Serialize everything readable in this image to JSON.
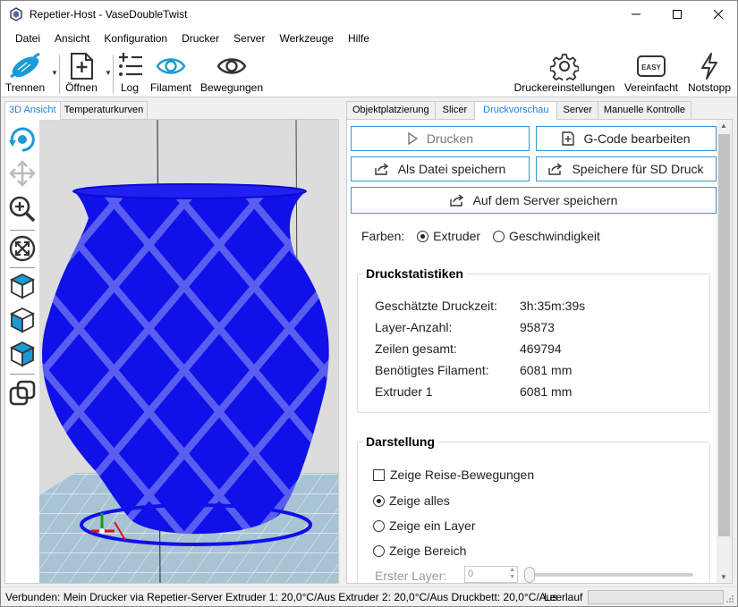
{
  "window": {
    "title": "Repetier-Host - VaseDoubleTwist"
  },
  "menu": [
    "Datei",
    "Ansicht",
    "Konfiguration",
    "Drucker",
    "Server",
    "Werkzeuge",
    "Hilfe"
  ],
  "toolbar": {
    "trennen": "Trennen",
    "oeffnen": "Öffnen",
    "log": "Log",
    "filament": "Filament",
    "bewegungen": "Bewegungen",
    "druckereinstellungen": "Druckereinstellungen",
    "vereinfacht": "Vereinfacht",
    "easy_badge": "EASY",
    "notstopp": "Notstopp"
  },
  "left_tabs": [
    "3D Ansicht",
    "Temperaturkurven"
  ],
  "right_tabs": [
    "Objektplatzierung",
    "Slicer",
    "Druckvorschau",
    "Server",
    "Manuelle Kontrolle"
  ],
  "buttons": {
    "drucken": "Drucken",
    "gcode": "G-Code bearbeiten",
    "als_datei": "Als Datei speichern",
    "sd": "Speichere für SD Druck",
    "server": "Auf dem Server speichern"
  },
  "farben": {
    "label": "Farben:",
    "extruder": "Extruder",
    "geschwindigkeit": "Geschwindigkeit"
  },
  "stats": {
    "title": "Druckstatistiken",
    "rows": [
      {
        "label": "Geschätzte Druckzeit:",
        "value": "3h:35m:39s"
      },
      {
        "label": "Layer-Anzahl:",
        "value": "95873"
      },
      {
        "label": "Zeilen gesamt:",
        "value": "469794"
      },
      {
        "label": "Benötigtes Filament:",
        "value": "6081 mm"
      },
      {
        "label": "Extruder 1",
        "value": "6081 mm"
      }
    ]
  },
  "display": {
    "title": "Darstellung",
    "reise": "Zeige Reise-Bewegungen",
    "alles": "Zeige alles",
    "layer": "Zeige ein Layer",
    "bereich": "Zeige Bereich",
    "erster_layer": "Erster Layer:",
    "erster_layer_value": "0"
  },
  "status": {
    "text": "Verbunden: Mein Drucker via Repetier-Server Extruder 1: 20,0°C/Aus Extruder 2: 20,0°C/Aus Druckbett: 20,0°C/Aus",
    "state": "Leerlauf"
  },
  "colors": {
    "accent": "#1e7fd8",
    "model": "#1010e8"
  }
}
